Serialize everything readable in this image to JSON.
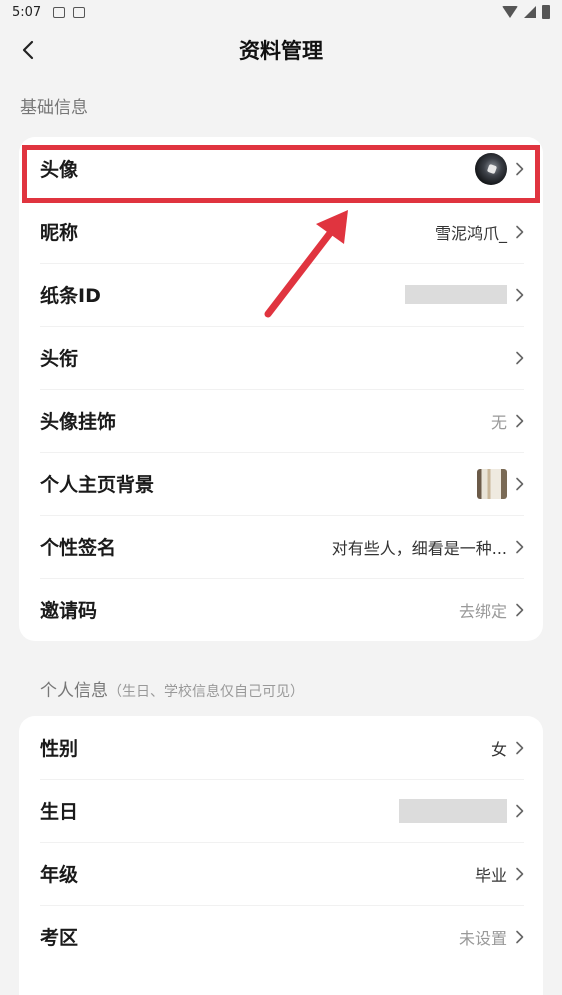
{
  "status_bar": {
    "time": "5:07"
  },
  "header": {
    "title": "资料管理"
  },
  "section_basic": {
    "label": "基础信息"
  },
  "basic_rows": [
    {
      "label": "头像",
      "value": ""
    },
    {
      "label": "昵称",
      "value": "雪泥鸿爪_"
    },
    {
      "label": "纸条ID",
      "value": ""
    },
    {
      "label": "头衔",
      "value": ""
    },
    {
      "label": "头像挂饰",
      "value": "无"
    },
    {
      "label": "个人主页背景",
      "value": ""
    },
    {
      "label": "个性签名",
      "value": "对有些人，细看是一种..."
    },
    {
      "label": "邀请码",
      "value": "去绑定"
    }
  ],
  "section_personal": {
    "label": "个人信息",
    "note": "（生日、学校信息仅自己可见）"
  },
  "personal_rows": [
    {
      "label": "性别",
      "value": "女"
    },
    {
      "label": "生日",
      "value": ""
    },
    {
      "label": "年级",
      "value": "毕业"
    },
    {
      "label": "考区",
      "value": "未设置"
    }
  ],
  "colors": {
    "highlight": "#e0343f",
    "background": "#f3f3f3",
    "card": "#ffffff"
  },
  "icons": {
    "back": "chevron-left-icon",
    "row_arrow": "chevron-right-icon"
  }
}
